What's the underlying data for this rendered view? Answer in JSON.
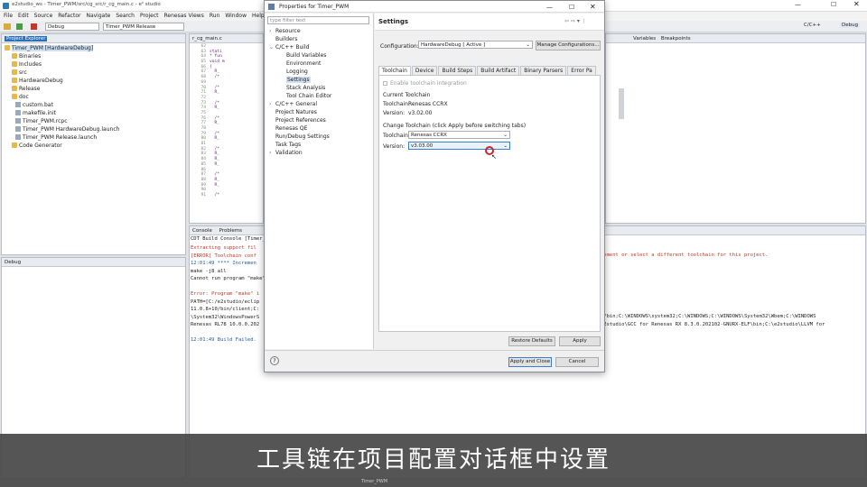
{
  "window": {
    "title": "e2studio_ws - Timer_PWM/src/cg_src/r_cg_main.c - e² studio"
  },
  "menu": [
    "File",
    "Edit",
    "Source",
    "Refactor",
    "Navigate",
    "Search",
    "Project",
    "Renesas Views",
    "Run",
    "Window",
    "Help"
  ],
  "toolbar": {
    "build_config": "Debug",
    "launch_config": "Timer_PWM Release",
    "perspective_cc": "C/C++",
    "perspective_debug": "Debug"
  },
  "project_explorer": {
    "title": "Project Explorer",
    "items": [
      "Timer_PWM [HardwareDebug]",
      "Binaries",
      "Includes",
      "src",
      "HardwareDebug",
      "Release",
      "doc",
      "custom.bat",
      "makefile.init",
      "Timer_PWM.rcpc",
      "Timer_PWM HardwareDebug.launch",
      "Timer_PWM Release.launch",
      "Code Generator"
    ]
  },
  "debug_panel": {
    "title": "Debug"
  },
  "editor": {
    "tab": "r_cg_main.c",
    "lines": [
      "62",
      "63",
      "64",
      "65",
      "66",
      "67",
      "68",
      "69",
      "70",
      "71",
      "72",
      "73",
      "74",
      "75",
      "76",
      "77",
      "78",
      "79",
      "80",
      "81",
      "82",
      "83",
      "84",
      "85",
      "86",
      "87",
      "88",
      "89",
      "90",
      "91"
    ],
    "code": [
      "",
      "stati",
      "* fun",
      "void m",
      "{",
      "  R_",
      "  /*",
      "",
      "  /*",
      "  R_",
      "",
      "  /*",
      "  R_",
      "",
      "  /*",
      "  R_",
      "",
      "  /*",
      "  R_",
      "",
      "  /*",
      "  R_",
      "  R_",
      "  R_",
      "",
      "  /*",
      "  R_",
      "  R_",
      "",
      "  /*"
    ]
  },
  "right_panels": {
    "variables": "Variables",
    "breakpoints": "Breakpoints"
  },
  "console": {
    "tabs": [
      "Console",
      "Problems"
    ],
    "header": "CDT Build Console [Timer_PWM]",
    "lines": [
      {
        "text": "Extracting support fil",
        "cls": "red"
      },
      {
        "text": "[ERROR] Toolchain conf",
        "cls": "red"
      },
      {
        "text": "12:01:49 **** Incremen",
        "cls": "blue"
      },
      {
        "text": "make -j8 all",
        "cls": ""
      },
      {
        "text": "Cannot run program \"make\"",
        "cls": ""
      },
      {
        "text": "",
        "cls": ""
      },
      {
        "text": "Error: Program \"make\" i",
        "cls": "red"
      },
      {
        "text": "PATH=[C:/e2studio/eclip",
        "cls": ""
      },
      {
        "text": "11.0.8+10/bin/client;C:",
        "cls": ""
      },
      {
        "text": "\\System32\\WindowsPowerS",
        "cls": ""
      },
      {
        "text": "Renesas RL78 10.0.0.202",
        "cls": ""
      },
      {
        "text": "",
        "cls": ""
      },
      {
        "text": "12:01:49 Build Failed.",
        "cls": "blue"
      }
    ],
    "right_lines": [
      {
        "text": "gement or select a different toolchain for this project.",
        "cls": "red"
      },
      {
        "text": "",
        "cls": ""
      },
      {
        "text": "",
        "cls": ""
      },
      {
        "text": "",
        "cls": ""
      },
      {
        "text": "",
        "cls": ""
      },
      {
        "text": "",
        "cls": ""
      },
      {
        "text": "",
        "cls": ""
      },
      {
        "text": "",
        "cls": ""
      },
      {
        "text": "8/bin;C:\\WINDOWS\\system32;C:\\WINDOWS;C:\\WINDOWS\\System32\\Wbem;C:\\WINDOWS",
        "cls": ""
      },
      {
        "text": "e2studio\\GCC for Renesas RX 8.3.0.202102-GNURX-ELF\\bin;C:\\e2studio\\LLVM for",
        "cls": ""
      }
    ]
  },
  "dialog": {
    "title": "Properties for Timer_PWM",
    "filter_placeholder": "type filter text",
    "nav": [
      {
        "label": "Resource",
        "indent": 1,
        "exp": ">"
      },
      {
        "label": "Builders",
        "indent": 1,
        "exp": ""
      },
      {
        "label": "C/C++ Build",
        "indent": 1,
        "exp": "v"
      },
      {
        "label": "Build Variables",
        "indent": 2,
        "exp": ""
      },
      {
        "label": "Environment",
        "indent": 2,
        "exp": ""
      },
      {
        "label": "Logging",
        "indent": 2,
        "exp": ""
      },
      {
        "label": "Settings",
        "indent": 2,
        "exp": "",
        "sel": true
      },
      {
        "label": "Stack Analysis",
        "indent": 2,
        "exp": ""
      },
      {
        "label": "Tool Chain Editor",
        "indent": 2,
        "exp": ""
      },
      {
        "label": "C/C++ General",
        "indent": 1,
        "exp": ">"
      },
      {
        "label": "Project Natures",
        "indent": 1,
        "exp": ""
      },
      {
        "label": "Project References",
        "indent": 1,
        "exp": ""
      },
      {
        "label": "Renesas QE",
        "indent": 1,
        "exp": ""
      },
      {
        "label": "Run/Debug Settings",
        "indent": 1,
        "exp": ""
      },
      {
        "label": "Task Tags",
        "indent": 1,
        "exp": ""
      },
      {
        "label": "Validation",
        "indent": 1,
        "exp": ">"
      }
    ],
    "settings_title": "Settings",
    "configuration_label": "Configuration:",
    "configuration_value": "HardwareDebug  [ Active ]",
    "manage_button": "Manage Configurations...",
    "tabs": [
      "Toolchain",
      "Device",
      "Build Steps",
      "Build Artifact",
      "Binary Parsers",
      "Error Pa"
    ],
    "enable_integration": "Enable toolchain integration",
    "current_toolchain_header": "Current Toolchain",
    "current_toolchain_label": "Toolchain:",
    "current_toolchain_value": "Renesas CCRX",
    "current_version_label": "Version:",
    "current_version_value": "v3.02.00",
    "change_header": "Change Toolchain (click Apply before switching tabs)",
    "change_toolchain_label": "Toolchain:",
    "change_toolchain_value": "Renesas CCRX",
    "change_version_label": "Version:",
    "change_version_value": "v3.03.00",
    "restore_defaults": "Restore Defaults",
    "apply": "Apply",
    "apply_close": "Apply and Close",
    "cancel": "Cancel",
    "help": "?"
  },
  "statusbar": {
    "text": "Timer_PWM"
  },
  "subtitle": "工具链在项目配置对话框中设置"
}
